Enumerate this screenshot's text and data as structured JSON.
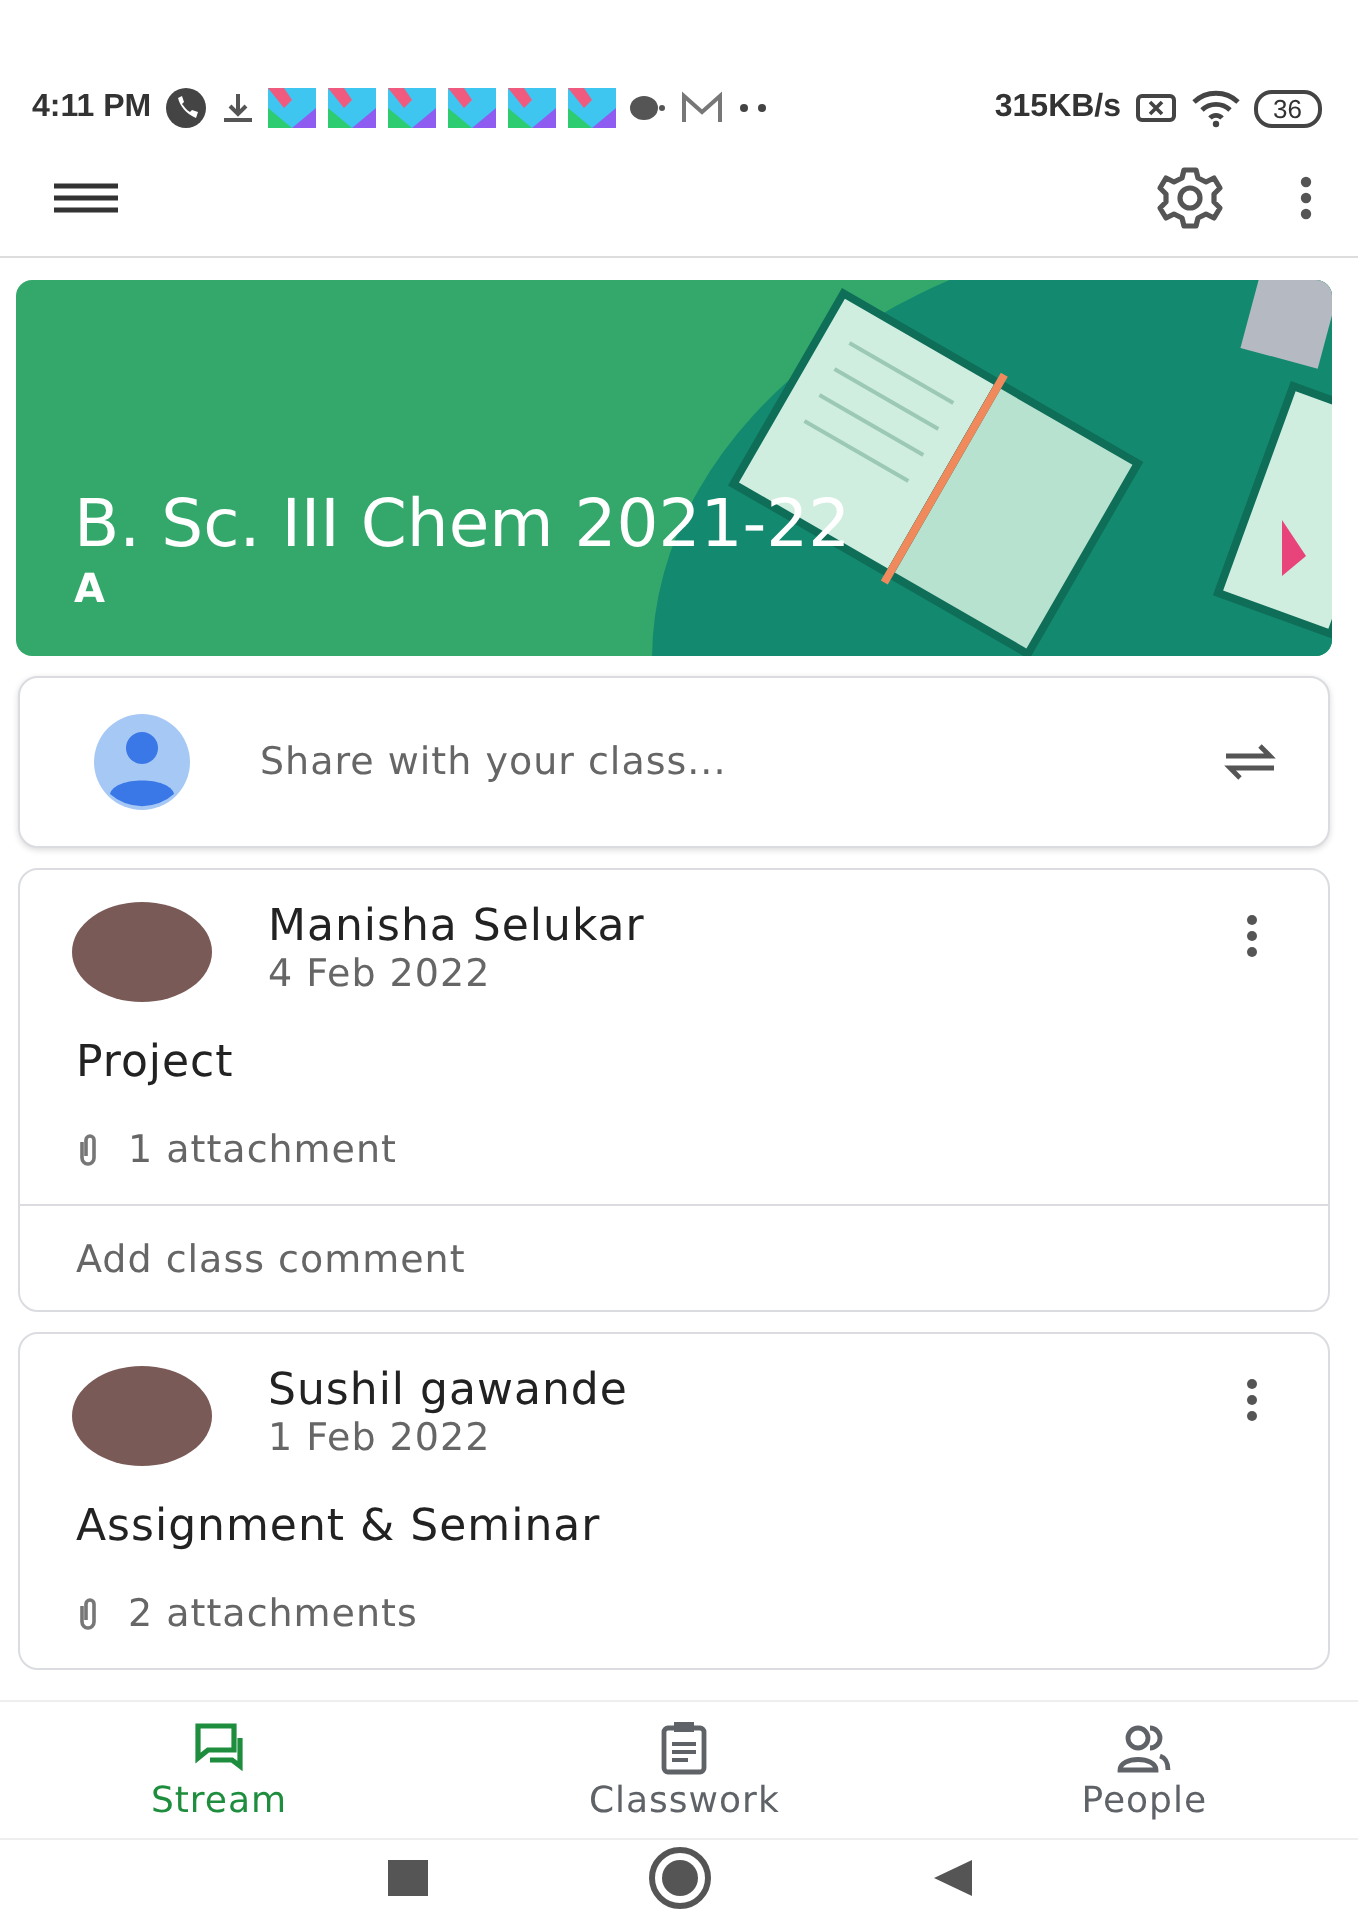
{
  "status_bar": {
    "time": "4:11 PM",
    "speed": "315KB/s",
    "battery": "36"
  },
  "class_banner": {
    "title": "B. Sc. III Chem 2021-22",
    "section": "A"
  },
  "share_prompt": "Share with your class...",
  "posts": [
    {
      "author": "Manisha Selukar",
      "date": "4 Feb 2022",
      "title": "Project",
      "attachments": "1 attachment",
      "comment_prompt": "Add class comment"
    },
    {
      "author": "Sushil gawande",
      "date": "1 Feb 2022",
      "title": "Assignment & Seminar",
      "attachments": "2 attachments"
    }
  ],
  "tabs": [
    {
      "kind": "stream",
      "label": "Stream",
      "selected": true
    },
    {
      "kind": "classwork",
      "label": "Classwork",
      "selected": false
    },
    {
      "kind": "people",
      "label": "People",
      "selected": false
    }
  ]
}
